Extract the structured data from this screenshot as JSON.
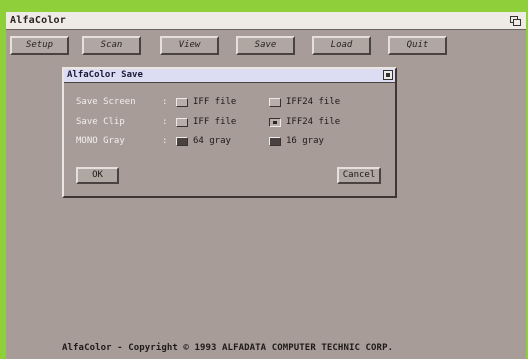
{
  "window": {
    "title": "AlfaColor"
  },
  "toolbar": {
    "buttons": [
      {
        "label": "Setup"
      },
      {
        "label": "Scan"
      },
      {
        "label": "View"
      },
      {
        "label": "Save"
      },
      {
        "label": "Load"
      },
      {
        "label": "Quit"
      }
    ]
  },
  "dialog": {
    "title": "AlfaColor Save",
    "rows": [
      {
        "label": "Save Screen",
        "colon": ":",
        "options": [
          {
            "label": "IFF file",
            "state": "off"
          },
          {
            "label": "IFF24 file",
            "state": "off"
          }
        ]
      },
      {
        "label": "Save Clip",
        "colon": ":",
        "options": [
          {
            "label": "IFF file",
            "state": "off"
          },
          {
            "label": "IFF24 file",
            "state": "on"
          }
        ]
      },
      {
        "label": "MONO Gray",
        "colon": ":",
        "options": [
          {
            "label": "64 gray",
            "state": "filled"
          },
          {
            "label": "16 gray",
            "state": "filled"
          }
        ]
      }
    ],
    "ok_label": "OK",
    "cancel_label": "Cancel"
  },
  "footer": {
    "copyright": "AlfaColor - Copyright © 1993 ALFADATA COMPUTER TECHNIC CORP."
  },
  "colors": {
    "desktop": "#a89c98",
    "border_green": "#8fd03a",
    "title_bar": "#eeeae6",
    "dialog_title_bar": "#dcdcf2"
  }
}
